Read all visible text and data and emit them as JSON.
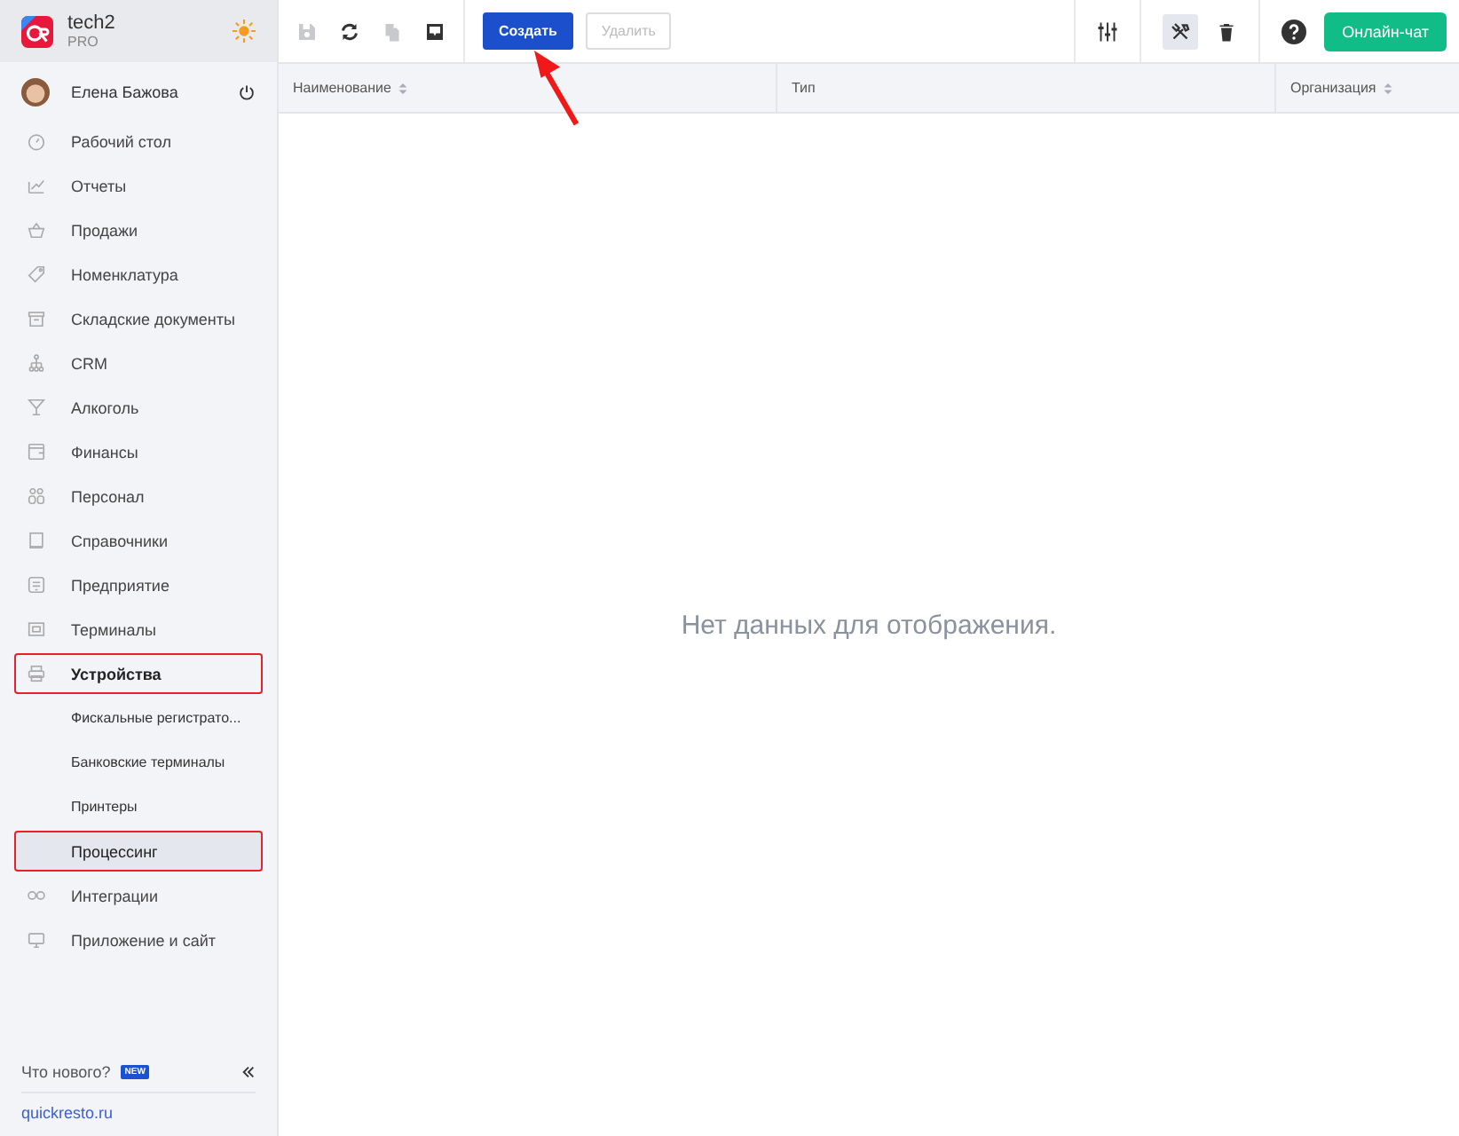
{
  "brand": {
    "name": "tech2",
    "plan": "PRO"
  },
  "user": {
    "name": "Елена Бажова"
  },
  "menu": [
    {
      "label": "Рабочий стол",
      "selected": false,
      "outlined": false
    },
    {
      "label": "Отчеты",
      "selected": false,
      "outlined": false
    },
    {
      "label": "Продажи",
      "selected": false,
      "outlined": false
    },
    {
      "label": "Номенклатура",
      "selected": false,
      "outlined": false
    },
    {
      "label": "Складские документы",
      "selected": false,
      "outlined": false
    },
    {
      "label": "CRM",
      "selected": false,
      "outlined": false
    },
    {
      "label": "Алкоголь",
      "selected": false,
      "outlined": false
    },
    {
      "label": "Финансы",
      "selected": false,
      "outlined": false
    },
    {
      "label": "Персонал",
      "selected": false,
      "outlined": false
    },
    {
      "label": "Справочники",
      "selected": false,
      "outlined": false
    },
    {
      "label": "Предприятие",
      "selected": false,
      "outlined": false
    },
    {
      "label": "Терминалы",
      "selected": false,
      "outlined": false
    },
    {
      "label": "Устройства",
      "selected": false,
      "outlined": true,
      "expanded": true,
      "children": [
        {
          "label": "Фискальные регистрато...",
          "selected": false,
          "outlined": false
        },
        {
          "label": "Банковские терминалы",
          "selected": false,
          "outlined": false
        },
        {
          "label": "Принтеры",
          "selected": false,
          "outlined": false
        },
        {
          "label": "Процессинг",
          "selected": true,
          "outlined": true
        }
      ]
    },
    {
      "label": "Интеграции",
      "selected": false,
      "outlined": false
    },
    {
      "label": "Приложение и сайт",
      "selected": false,
      "outlined": false
    }
  ],
  "whats_new": {
    "label": "Что нового?",
    "badge": "NEW"
  },
  "site_link": "quickresto.ru",
  "toolbar": {
    "icons": [
      {
        "kind": "save",
        "disabled": true
      },
      {
        "kind": "refresh",
        "disabled": false
      },
      {
        "kind": "copy",
        "disabled": true
      },
      {
        "kind": "inbox",
        "disabled": false
      }
    ],
    "buttons": [
      {
        "label": "Создать",
        "disabled": false
      },
      {
        "label": "Удалить",
        "disabled": true
      }
    ],
    "tools_on": true,
    "chat_button": "Онлайн-чат"
  },
  "table": {
    "columns": [
      {
        "label": "Наименование",
        "sortable": true
      },
      {
        "label": "Тип",
        "sortable": false
      },
      {
        "label": "Организация",
        "sortable": true
      }
    ],
    "empty_text": "Нет данных для отображения."
  },
  "annotation_arrow": true
}
